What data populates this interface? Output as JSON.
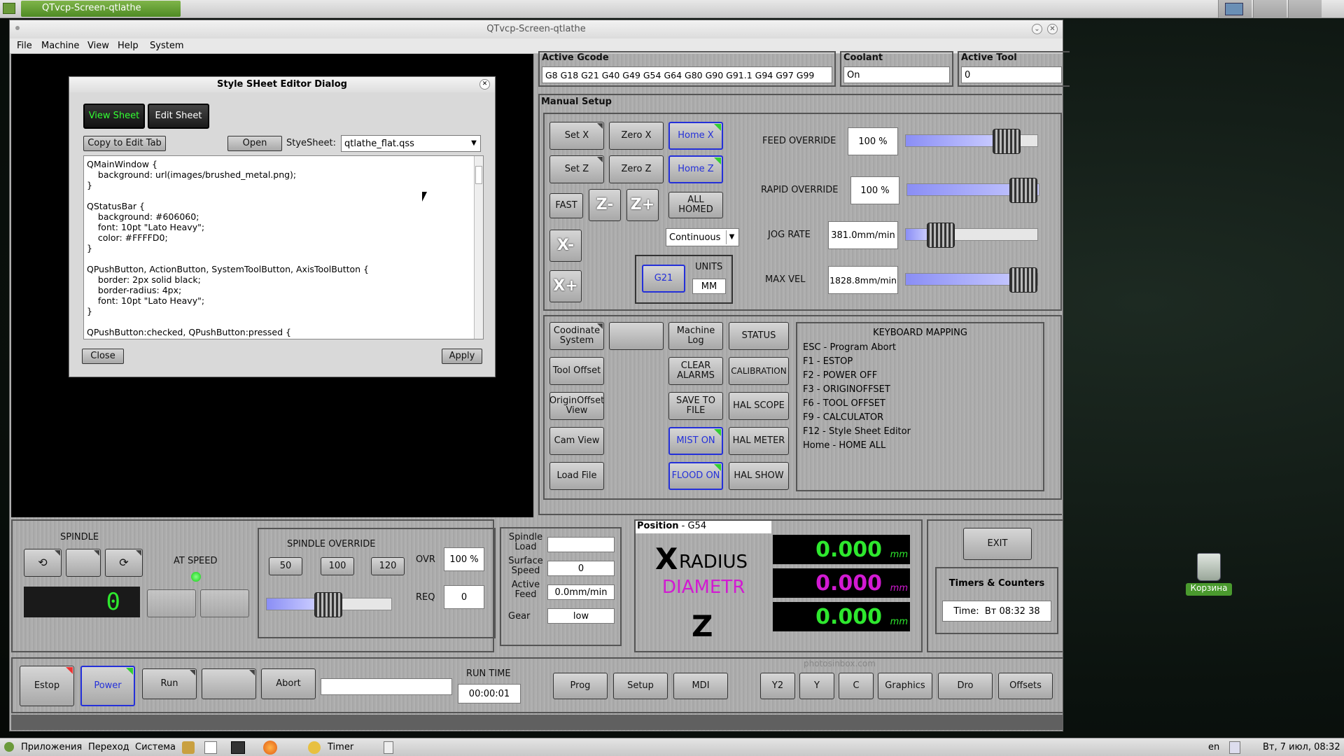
{
  "desktop": {
    "active_task": "QTvcp-Screen-qtlathe",
    "trash_label": "Корзина",
    "taskbar": {
      "apps": "Приложения",
      "go": "Переход",
      "system": "Система",
      "timer": "Timer",
      "lang": "en",
      "clock": "Вт, 7 июл, 08:32"
    }
  },
  "window": {
    "title": "QTvcp-Screen-qtlathe",
    "menu": [
      "File",
      "Machine",
      "View",
      "Help",
      "System"
    ]
  },
  "dialog": {
    "title": "Style SHeet Editor Dialog",
    "view_sheet": "View Sheet",
    "edit_sheet": "Edit Sheet",
    "copy_to_edit": "Copy to Edit Tab",
    "open": "Open",
    "stylesheet_label": "StyeSheet:",
    "stylesheet_value": "qtlathe_flat.qss",
    "editor_text": "QMainWindow {\n    background: url(images/brushed_metal.png);\n}\n\nQStatusBar {\n    background: #606060;\n    font: 10pt \"Lato Heavy\";\n    color: #FFFFD0;\n}\n\nQPushButton, ActionButton, SystemToolButton, AxisToolButton {\n    border: 2px solid black;\n    border-radius: 4px;\n    font: 10pt \"Lato Heavy\";\n}\n\nQPushButton:checked, QPushButton:pressed {",
    "close": "Close",
    "apply": "Apply"
  },
  "preview": {
    "axis_label": "X"
  },
  "status": {
    "active_gcode_title": "Active Gcode",
    "active_gcode_value": "G8 G18 G21 G40 G49 G54 G64 G80 G90 G91.1 G94 G97 G99",
    "coolant_title": "Coolant",
    "coolant_value": "On",
    "active_tool_title": "Active Tool",
    "active_tool_value": "0"
  },
  "manual": {
    "title": "Manual Setup",
    "set_x": "Set X",
    "zero_x": "Zero X",
    "home_x": "Home X",
    "set_z": "Set Z",
    "zero_z": "Zero Z",
    "home_z": "Home Z",
    "fast": "FAST",
    "z_minus": "Z-",
    "z_plus": "Z+",
    "all_homed": "ALL HOMED",
    "x_minus": "X-",
    "x_plus": "X+",
    "jog_mode": "Continuous",
    "g21": "G21",
    "units_label": "UNITS",
    "units_value": "MM",
    "feed_override_label": "FEED OVERRIDE",
    "feed_override_value": "100 %",
    "feed_override_level": 100,
    "rapid_override_label": "RAPID OVERRIDE",
    "rapid_override_value": "100 %",
    "rapid_override_level": 100,
    "jog_rate_label": "JOG RATE",
    "jog_rate_value": "381.0mm/min",
    "max_vel_label": "MAX VEL",
    "max_vel_value": "1828.8mm/min"
  },
  "tools": {
    "coord_system": "Coodinate System",
    "machine_log": "Machine Log",
    "status": "STATUS",
    "tool_offset": "Tool Offset",
    "clear_alarms": "CLEAR ALARMS",
    "calibration": "CALIBRATION",
    "origin_offset_view": "OriginOffset View",
    "save_to_file": "SAVE TO FILE",
    "hal_scope": "HAL SCOPE",
    "cam_view": "Cam View",
    "mist_on": "MIST ON",
    "hal_meter": "HAL METER",
    "load_file": "Load File",
    "flood_on": "FLOOD ON",
    "hal_show": "HAL SHOW",
    "keyboard_title": "KEYBOARD MAPPING",
    "keyboard": [
      "ESC - Program Abort",
      "F1 - ESTOP",
      "F2 - POWER OFF",
      "F3 - ORIGINOFFSET",
      "F6 - TOOL OFFSET",
      "F9 - CALCULATOR",
      "F12 - Style Sheet Editor",
      "Home - HOME ALL"
    ]
  },
  "spindle": {
    "title": "SPINDLE",
    "at_speed": "AT SPEED",
    "display": "0",
    "override_title": "SPINDLE OVERRIDE",
    "p50": "50",
    "p100": "100",
    "p120": "120",
    "ovr_label": "OVR",
    "ovr_value": "100 %",
    "req_label": "REQ",
    "req_value": "0",
    "load_label": "Spindle Load",
    "load_value": "",
    "surface_label": "Surface Speed",
    "surface_value": "0",
    "feed_label": "Active Feed",
    "feed_value": "0.0mm/min",
    "gear_label": "Gear",
    "gear_value": "low"
  },
  "position": {
    "title": "Position",
    "coord": " - G54",
    "x_letter": "X",
    "radius": "RADIUS",
    "diametr": "DIAMETR",
    "z_letter": "Z",
    "x_value": "0.000",
    "d_value": "0.000",
    "z_value": "0.000",
    "unit": "mm"
  },
  "timers": {
    "exit": "EXIT",
    "title": "Timers & Counters",
    "time_label": "Time:",
    "time_value": "Вт 08:32 38"
  },
  "bottom": {
    "estop": "Estop",
    "power": "Power",
    "run": "Run",
    "abort": "Abort",
    "run_time_label": "RUN TIME",
    "run_time_value": "00:00:01",
    "prog": "Prog",
    "setup": "Setup",
    "mdi": "MDI",
    "y2": "Y2",
    "y": "Y",
    "c": "C",
    "graphics": "Graphics",
    "dro": "Dro",
    "offsets": "Offsets",
    "watermark": "photosinbox.com"
  }
}
